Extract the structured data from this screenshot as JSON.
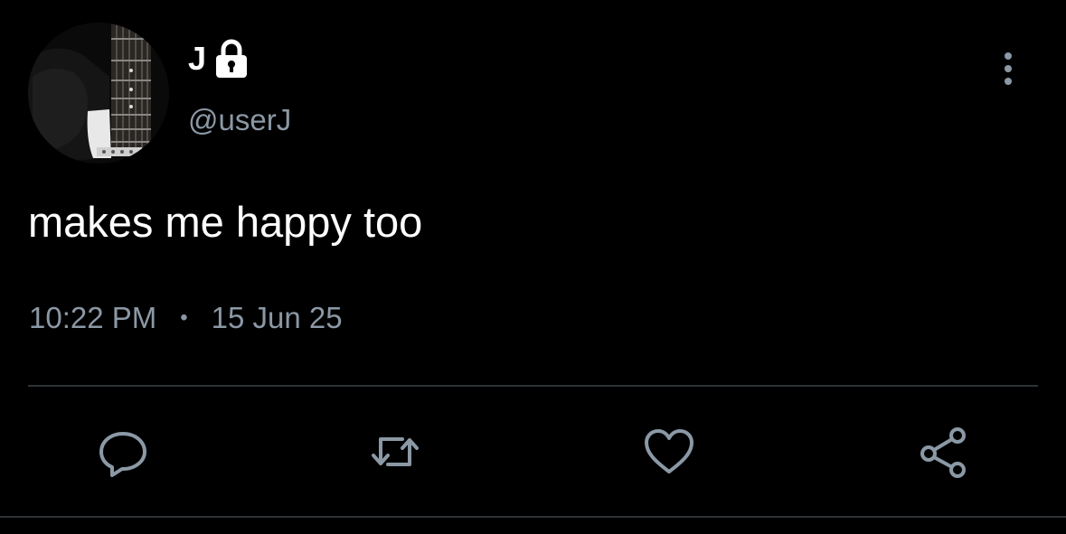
{
  "tweet": {
    "author": {
      "display_name": "J",
      "handle": "@userJ",
      "protected_icon": "lock-icon",
      "avatar": "guitar-photo"
    },
    "text": "makes me happy too",
    "time": "10:22 PM",
    "separator": "•",
    "date": "15 Jun 25"
  },
  "actions": {
    "more": "more-vertical-icon",
    "reply": "reply-icon",
    "retweet": "retweet-icon",
    "like": "heart-icon",
    "share": "share-icon"
  },
  "colors": {
    "background": "#000000",
    "text_primary": "#ffffff",
    "text_secondary": "#8b98a5",
    "divider": "#2f3336",
    "icon": "#8b98a5"
  }
}
